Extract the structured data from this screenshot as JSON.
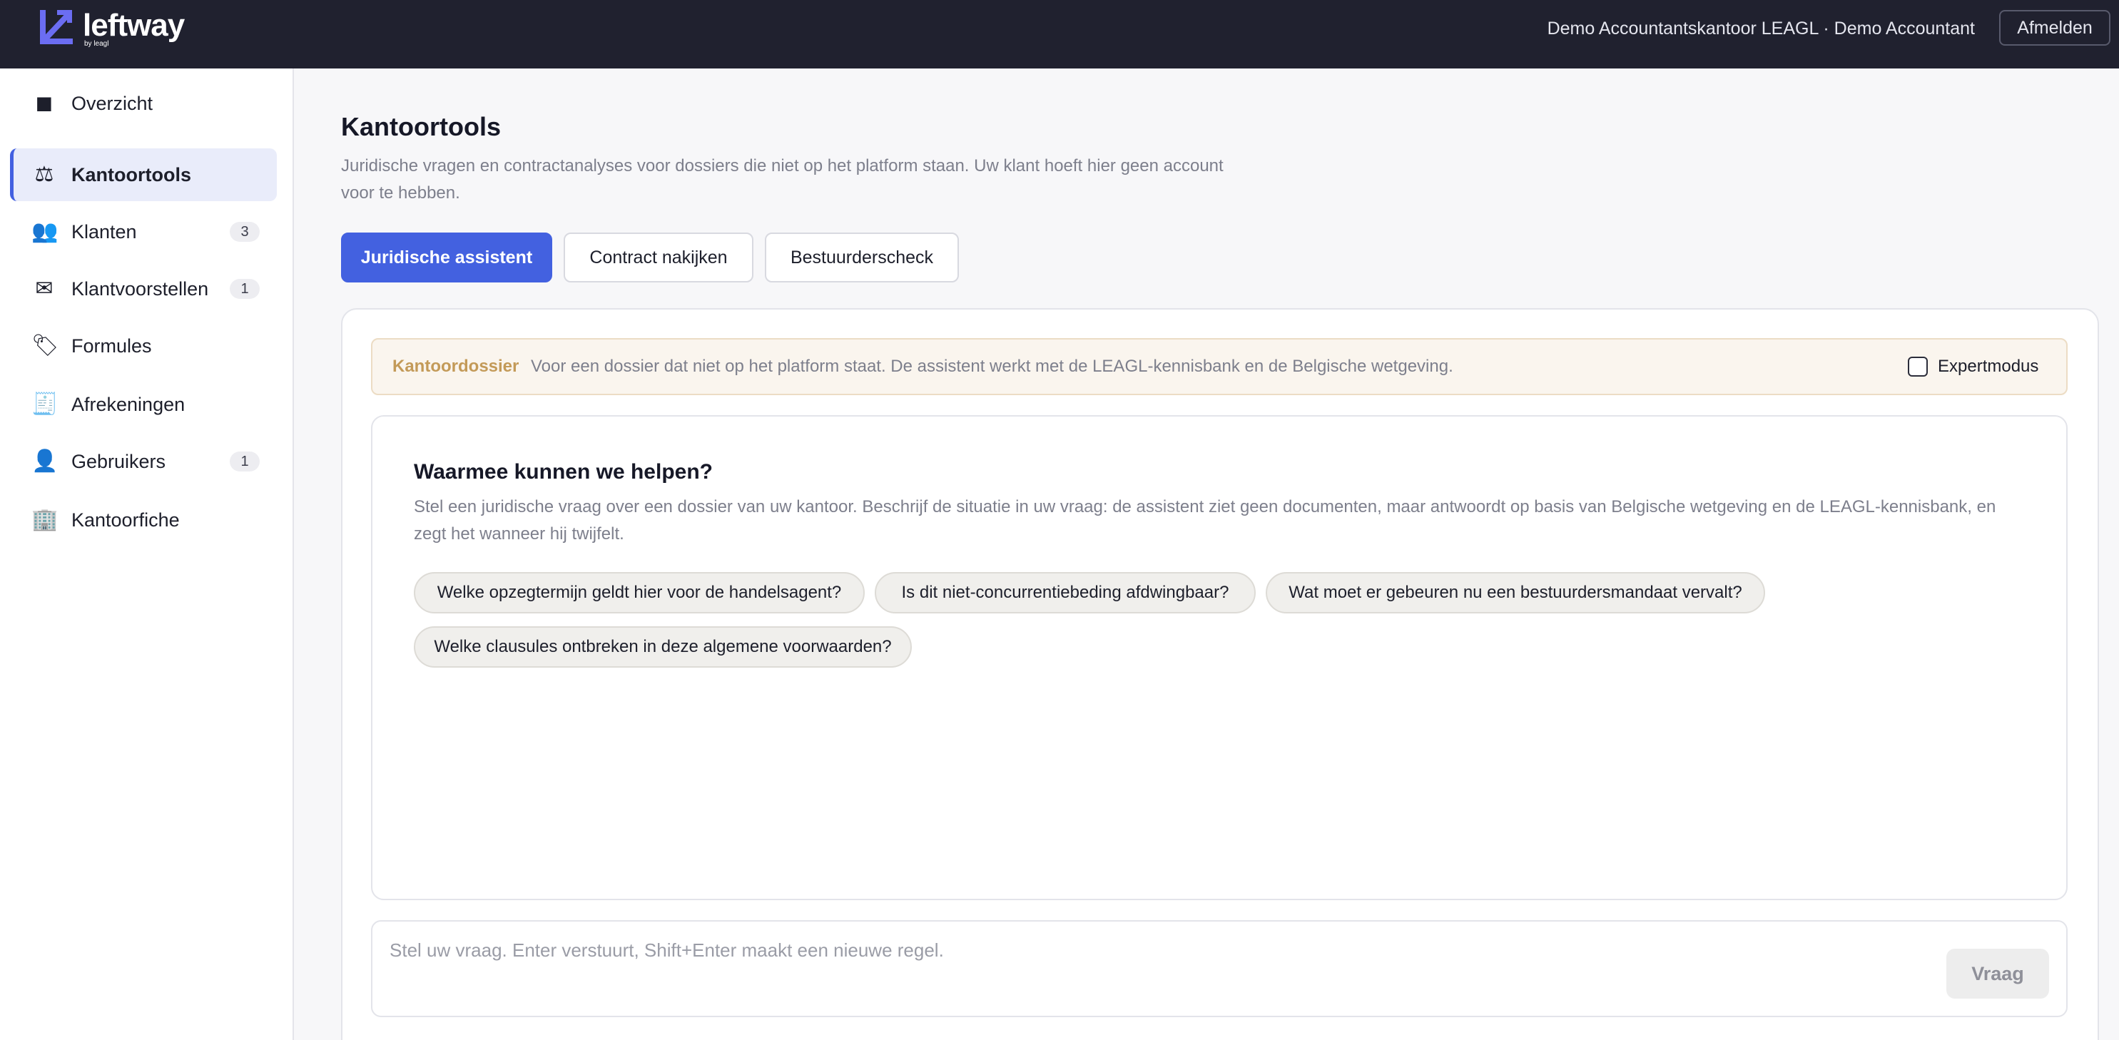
{
  "brand": {
    "name": "leftway",
    "sub": "by leagl",
    "accent": "#4361e0",
    "dark": "#20212f"
  },
  "header": {
    "user_info": "Demo Accountantskantoor LEAGL · Demo Accountant",
    "logout_label": "Afmelden"
  },
  "sidebar": {
    "items": [
      {
        "label": "Overzicht",
        "icon": "grid-square-icon",
        "glyph": "◼",
        "badge": null,
        "active": false
      },
      {
        "label": "Kantoortools",
        "icon": "scales-icon",
        "glyph": "⚖",
        "badge": null,
        "active": true
      },
      {
        "label": "Klanten",
        "icon": "people-icon",
        "glyph": "👥",
        "badge": "3",
        "active": false
      },
      {
        "label": "Klantvoorstellen",
        "icon": "envelope-icon",
        "glyph": "✉",
        "badge": "1",
        "active": false
      },
      {
        "label": "Formules",
        "icon": "tag-icon",
        "glyph": "🏷",
        "badge": null,
        "active": false
      },
      {
        "label": "Afrekeningen",
        "icon": "receipt-icon",
        "glyph": "🧾",
        "badge": null,
        "active": false
      },
      {
        "label": "Gebruikers",
        "icon": "user-icon",
        "glyph": "👤",
        "badge": "1",
        "active": false
      },
      {
        "label": "Kantoorfiche",
        "icon": "building-icon",
        "glyph": "🏢",
        "badge": null,
        "active": false
      }
    ]
  },
  "main": {
    "title": "Kantoortools",
    "subtitle": "Juridische vragen en contractanalyses voor dossiers die niet op het platform staan. Uw klant hoeft hier geen account voor te hebben.",
    "tabs": [
      {
        "label": "Juridische assistent",
        "active": true
      },
      {
        "label": "Contract nakijken",
        "active": false
      },
      {
        "label": "Bestuurderscheck",
        "active": false
      }
    ],
    "notice": {
      "tag": "Kantoordossier",
      "text": "Voor een dossier dat niet op het platform staat. De assistent werkt met de LEAGL-kennisbank en de Belgische wetgeving.",
      "expert_label": "Expertmodus",
      "expert_checked": false
    },
    "chat": {
      "title": "Waarmee kunnen we helpen?",
      "description": "Stel een juridische vraag over een dossier van uw kantoor. Beschrijf de situatie in uw vraag: de assistent ziet geen documenten, maar antwoordt op basis van Belgische wetgeving en de LEAGL-kennisbank, en zegt het wanneer hij twijfelt.",
      "suggestions": [
        "Welke opzegtermijn geldt hier voor de handelsagent?",
        "Is dit niet-concurrentiebeding afdwingbaar?",
        "Wat moet er gebeuren nu een bestuurdersmandaat vervalt?",
        "Welke clausules ontbreken in deze algemene voorwaarden?"
      ]
    },
    "composer": {
      "placeholder": "Stel uw vraag. Enter verstuurt, Shift+Enter maakt een nieuwe regel.",
      "value": "",
      "send_label": "Vraag"
    }
  }
}
